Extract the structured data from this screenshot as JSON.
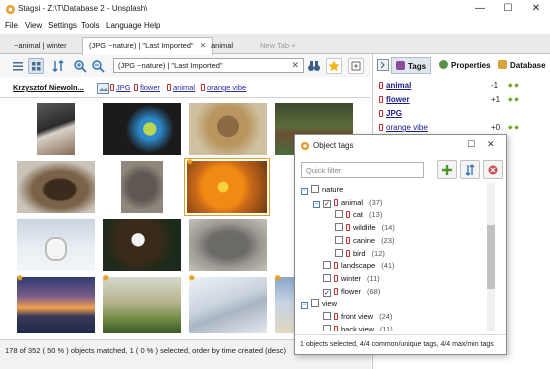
{
  "window": {
    "title": "Stagsi - Z:\\T\\Database 2 - Unsplash\\",
    "minimize": "—",
    "maximize": "☐",
    "close": "✕"
  },
  "menu": [
    "File",
    "View",
    "Settings",
    "Tools",
    "Language",
    "Help"
  ],
  "tabs": [
    {
      "label": "~animal | winter",
      "active": false
    },
    {
      "label": "(JPG ~nature) | \"Last Imported\"",
      "active": true
    },
    {
      "label": "animal",
      "active": false
    },
    {
      "label": "New Tab +",
      "active": false
    }
  ],
  "tab_close": "✕",
  "search": {
    "value": "(JPG ~nature) | \"Last Imported\"",
    "clear": "✕"
  },
  "pathbar": {
    "author": "Krzysztof Niewoln...",
    "tags": [
      "JPG",
      "flower",
      "animal",
      "orange vibe"
    ]
  },
  "icons": {
    "app": "stagsi-logo-icon",
    "view1": "list-view-icon",
    "view2": "grid-view-icon",
    "sort": "sort-icon",
    "zoom_in": "zoom-in-icon",
    "zoom_out": "zoom-out-icon",
    "binoculars": "binoculars-icon",
    "star": "star-icon",
    "expand": "expand-icon"
  },
  "thumbnails": [
    {
      "desc": "puffin",
      "star": false,
      "selected": false
    },
    {
      "desc": "parrots",
      "star": false,
      "selected": false
    },
    {
      "desc": "lion",
      "star": false,
      "selected": false
    },
    {
      "desc": "bear",
      "star": false,
      "selected": false
    },
    {
      "desc": "ducks",
      "star": false,
      "selected": false
    },
    {
      "desc": "elephant",
      "star": false,
      "selected": false
    },
    {
      "desc": "orange-flower",
      "star": true,
      "selected": true
    },
    {
      "desc": "owl",
      "star": false,
      "selected": false
    },
    {
      "desc": "eagle",
      "star": false,
      "selected": false
    },
    {
      "desc": "rhino",
      "star": false,
      "selected": false
    },
    {
      "desc": "sunset",
      "star": true,
      "selected": false
    },
    {
      "desc": "landscape",
      "star": true,
      "selected": false
    },
    {
      "desc": "dunes",
      "star": true,
      "selected": false
    }
  ],
  "status": "178 of 352 ( 50 % ) objects matched, 1 ( 0 % ) selected, order by time created (desc)",
  "right_panel": {
    "tabs": [
      "Tags",
      "Properties",
      "Database"
    ],
    "tags": [
      {
        "name": "animal",
        "count": "-1",
        "bold": true
      },
      {
        "name": "flower",
        "count": "+1",
        "bold": true
      },
      {
        "name": "JPG",
        "count": "",
        "bold": true
      },
      {
        "name": "orange vibe",
        "count": "+0",
        "bold": false
      }
    ]
  },
  "dialog": {
    "title": "Object tags",
    "close": "✕",
    "maximize": "☐",
    "quick_filter_placeholder": "Quick filter",
    "tree": [
      {
        "label": "nature",
        "level": 0,
        "expand": "−",
        "checked": false,
        "count": "",
        "tagicon": false
      },
      {
        "label": "animal",
        "level": 1,
        "expand": "−",
        "checked": true,
        "count": "(37)",
        "tagicon": true
      },
      {
        "label": "cat",
        "level": 2,
        "expand": "",
        "checked": false,
        "count": "(13)",
        "tagicon": true
      },
      {
        "label": "wildlife",
        "level": 2,
        "expand": "",
        "checked": false,
        "count": "(14)",
        "tagicon": true
      },
      {
        "label": "canine",
        "level": 2,
        "expand": "",
        "checked": false,
        "count": "(23)",
        "tagicon": true
      },
      {
        "label": "bird",
        "level": 2,
        "expand": "",
        "checked": false,
        "count": "(12)",
        "tagicon": true
      },
      {
        "label": "landscape",
        "level": 1,
        "expand": "",
        "checked": false,
        "count": "(41)",
        "tagicon": true
      },
      {
        "label": "winter",
        "level": 1,
        "expand": "",
        "checked": false,
        "count": "(11)",
        "tagicon": true
      },
      {
        "label": "flower",
        "level": 1,
        "expand": "",
        "checked": true,
        "count": "(68)",
        "tagicon": true
      },
      {
        "label": "view",
        "level": 0,
        "expand": "−",
        "checked": false,
        "count": "",
        "tagicon": false
      },
      {
        "label": "front view",
        "level": 1,
        "expand": "",
        "checked": false,
        "count": "(24)",
        "tagicon": true
      },
      {
        "label": "back view",
        "level": 1,
        "expand": "",
        "checked": false,
        "count": "(11)",
        "tagicon": true
      }
    ],
    "status": "1 objects selected, 4/4 common/unique tags, 4/4 max/min tags"
  }
}
